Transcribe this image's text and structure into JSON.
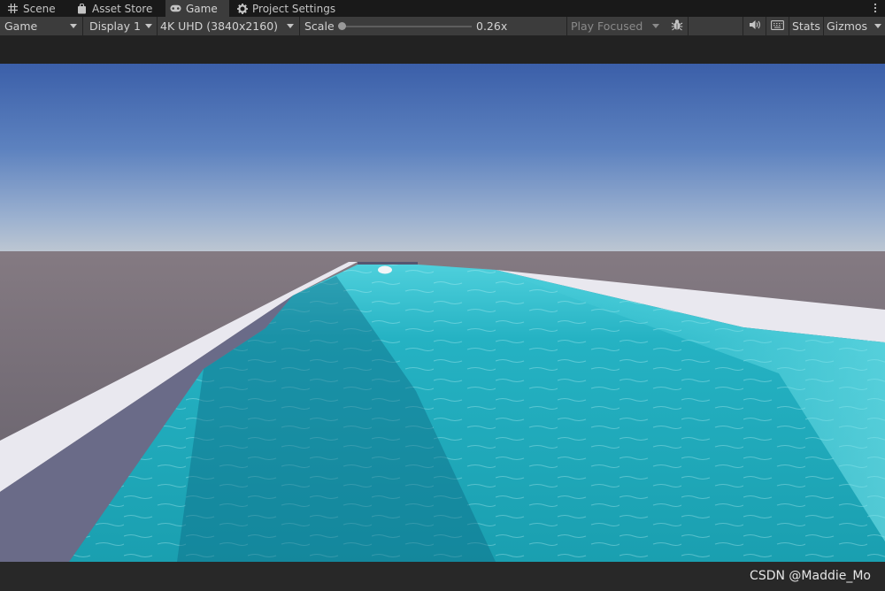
{
  "tabs": [
    {
      "label": "Scene",
      "icon": "grid-icon"
    },
    {
      "label": "Asset Store",
      "icon": "shopping-bag-icon"
    },
    {
      "label": "Game",
      "icon": "gamepad-icon",
      "active": true
    },
    {
      "label": "Project Settings",
      "icon": "gear-icon"
    }
  ],
  "toolbar": {
    "view_mode": "Game",
    "display": "Display 1",
    "resolution": "4K UHD (3840x2160)",
    "scale_label": "Scale",
    "scale_value": "0.26x",
    "scale_level": 0.26,
    "play_mode": "Play Focused",
    "stats_label": "Stats",
    "gizmos_label": "Gizmos"
  },
  "colors": {
    "tab_bar": "#191919",
    "toolbar": "#3c3c3c",
    "active_tab": "#3c3c3c",
    "text": "#c4c4c4",
    "sky_top": "#3b5fa9",
    "sky_horizon": "#b3c3d4",
    "water": "#1aa4b4"
  },
  "watermark": "CSDN @Maddie_Mo"
}
